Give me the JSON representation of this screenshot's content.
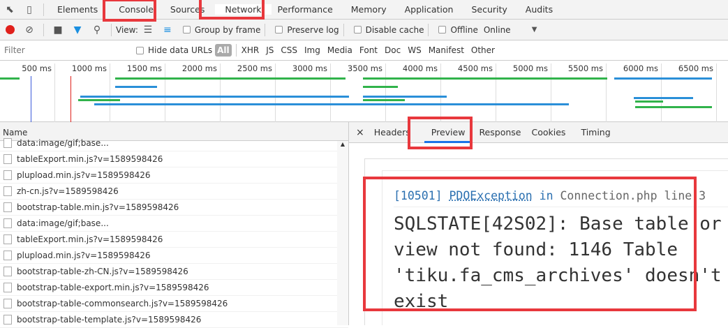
{
  "tabs": [
    "Elements",
    "Console",
    "Sources",
    "Network",
    "Performance",
    "Memory",
    "Application",
    "Security",
    "Audits"
  ],
  "toolbar": {
    "view_label": "View:",
    "group_by_frame": "Group by frame",
    "preserve_log": "Preserve log",
    "disable_cache": "Disable cache",
    "offline": "Offline",
    "throttle": "Online"
  },
  "filters": {
    "placeholder": "Filter",
    "hide_data_urls": "Hide data URLs",
    "types": [
      "All",
      "XHR",
      "JS",
      "CSS",
      "Img",
      "Media",
      "Font",
      "Doc",
      "WS",
      "Manifest",
      "Other"
    ]
  },
  "timeline": {
    "ticks": [
      "500 ms",
      "1000 ms",
      "1500 ms",
      "2000 ms",
      "2500 ms",
      "3000 ms",
      "3500 ms",
      "4000 ms",
      "4500 ms",
      "5000 ms",
      "5500 ms",
      "6000 ms",
      "6500 ms"
    ]
  },
  "requests": {
    "header": "Name",
    "rows": [
      "data:image/gif;base...",
      "tableExport.min.js?v=1589598426",
      "plupload.min.js?v=1589598426",
      "zh-cn.js?v=1589598426",
      "bootstrap-table.min.js?v=1589598426",
      "data:image/gif;base...",
      "tableExport.min.js?v=1589598426",
      "plupload.min.js?v=1589598426",
      "bootstrap-table-zh-CN.js?v=1589598426",
      "bootstrap-table-export.min.js?v=1589598426",
      "bootstrap-table-commonsearch.js?v=1589598426",
      "bootstrap-table-template.js?v=1589598426"
    ]
  },
  "detail": {
    "close": "×",
    "tabs": [
      "Headers",
      "Preview",
      "Response",
      "Cookies",
      "Timing"
    ],
    "exception": {
      "code": "[10501]",
      "class": "PDOException",
      "in": "in",
      "file": "Connection.php line 3"
    },
    "message": "SQLSTATE[42S02]: Base table or view not found: 1146 Table 'tiku.fa_cms_archives' doesn't exist"
  },
  "colors": {
    "annotation": "#e8383d",
    "record": "#e0201b",
    "accent": "#1a73e8"
  }
}
